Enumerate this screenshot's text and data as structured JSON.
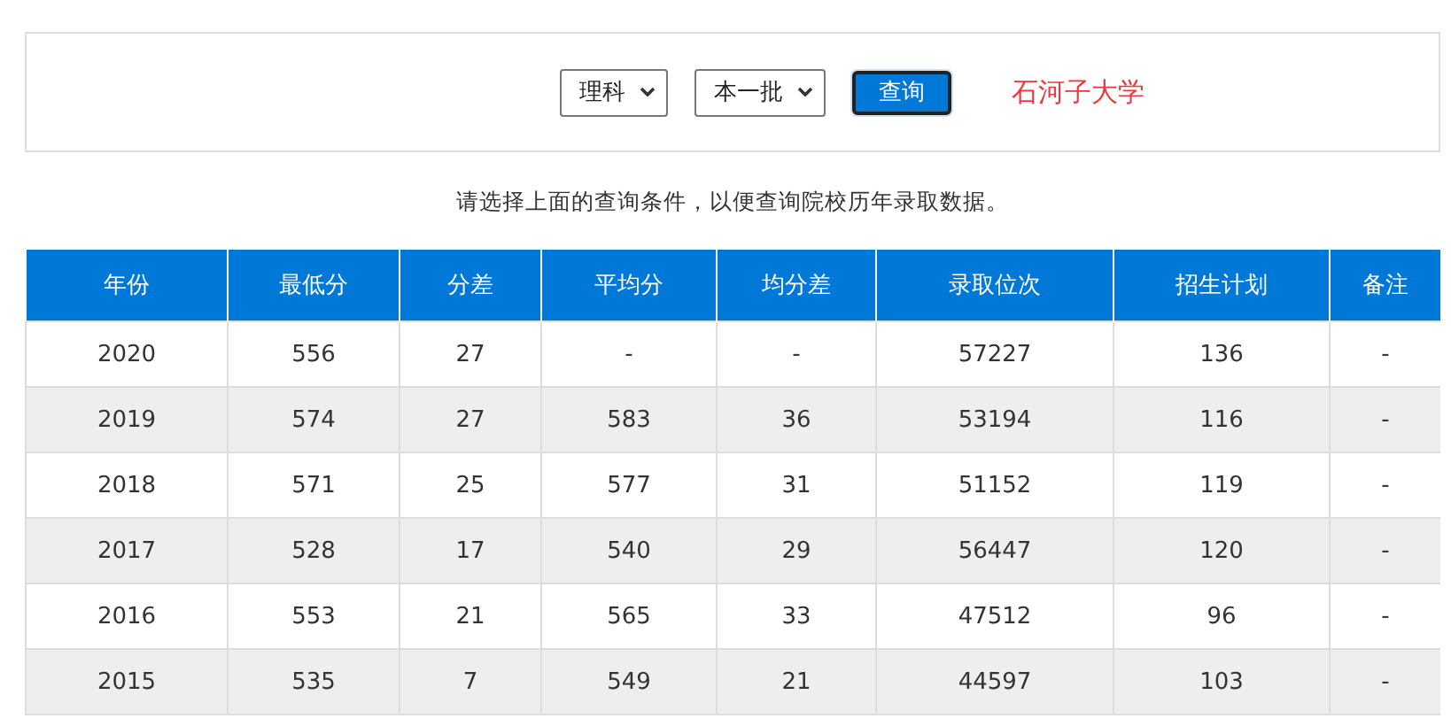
{
  "filters": [
    {
      "value": "理科"
    },
    {
      "value": "本一批"
    }
  ],
  "query_button": "查询",
  "school": "石河子大学",
  "hint": "请选择上面的查询条件，以便查询院校历年录取数据。",
  "table": {
    "columns": [
      "年份",
      "最低分",
      "分差",
      "平均分",
      "均分差",
      "录取位次",
      "招生计划",
      "备注"
    ],
    "rows": [
      [
        "2020",
        "556",
        "27",
        "-",
        "-",
        "57227",
        "136",
        "-"
      ],
      [
        "2019",
        "574",
        "27",
        "583",
        "36",
        "53194",
        "116",
        "-"
      ],
      [
        "2018",
        "571",
        "25",
        "577",
        "31",
        "51152",
        "119",
        "-"
      ],
      [
        "2017",
        "528",
        "17",
        "540",
        "29",
        "56447",
        "120",
        "-"
      ],
      [
        "2016",
        "553",
        "21",
        "565",
        "33",
        "47512",
        "96",
        "-"
      ],
      [
        "2015",
        "535",
        "7",
        "549",
        "21",
        "44597",
        "103",
        "-"
      ]
    ]
  }
}
